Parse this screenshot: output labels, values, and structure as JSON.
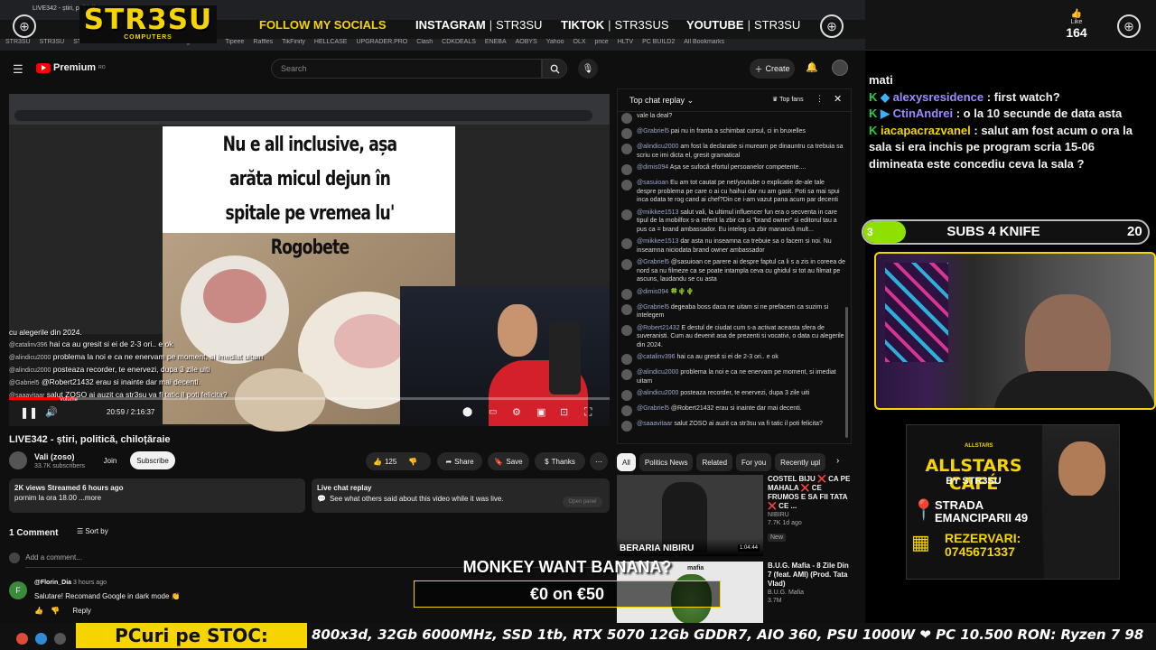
{
  "overlay": {
    "brand": "STR3SU",
    "brand_sub": "COMPUTERS",
    "follow": "FOLLOW MY SOCIALS",
    "socials": [
      {
        "platform": "INSTAGRAM",
        "handle": "STR3SU"
      },
      {
        "platform": "TIKTOK",
        "handle": "STR3SUS"
      },
      {
        "platform": "YOUTUBE",
        "handle": "STR3SU"
      }
    ],
    "like_label": "Like",
    "like_count": "164",
    "monkey_text": "MONKEY WANT BANANA?",
    "goal_text": "€0 on €50",
    "goal_progress": 0,
    "ticker_label": "PCuri pe STOC:",
    "ticker_text": "800x3d, 32Gb 6000MHz, SSD 1tb, RTX 5070 12Gb GDDR7, AIO 360, PSU 1000W  ❤ PC 10.500 RON: Ryzen 7 98"
  },
  "browser": {
    "tab_title": "LIVE342 - știri, politică...",
    "bookmarks": [
      "STR3SU",
      "STR3SU",
      "STR3SU",
      "STR3SUS",
      "STR3SUzu",
      "gambler.ro",
      "Tipeee",
      "Raffles",
      "TikFinity",
      "HELLCASE",
      "UPGRADER.PRO",
      "Clash",
      "CDKDEALS",
      "ENEBA",
      "AOBYS",
      "Yahoo",
      "OLX",
      "price",
      "HLTV",
      "PC BUILD2",
      "All Bookmarks"
    ]
  },
  "youtube": {
    "logo": "Premium",
    "logo_sup": "RO",
    "search_placeholder": "Search",
    "create": "Create",
    "video_title": "LIVE342 - știri, politică, chiloțăraie",
    "channel": "Vali (zoso)",
    "subscribers": "33.7K subscribers",
    "join": "Join",
    "subscribe": "Subscribe",
    "likes": "125",
    "share": "Share",
    "save": "Save",
    "thanks": "Thanks",
    "time": "20:59 / 2:16:37",
    "desc_line1": "2K views  Streamed 6 hours ago",
    "desc_line2": "pornim la ora 18.00 ...more",
    "chat_replay_title": "Live chat replay",
    "chat_replay_desc": "See what others said about this video while it was live.",
    "open_panel": "Open panel",
    "comments_count": "1 Comment",
    "sort_by": "Sort by",
    "add_comment": "Add a comment...",
    "comment_author": "@Florin_Dia",
    "comment_time": "3 hours ago",
    "comment_text": "Salutare! Recomand Google in dark mode 👏",
    "reply": "Reply",
    "volume_label": "Volume"
  },
  "meme": {
    "text": "Nu e all inclusive, așa arăta micul dejun în spitale pe vremea lu' Rogobete"
  },
  "video_overlay_chat": [
    {
      "user": "",
      "text": "cu alegerile din 2024."
    },
    {
      "user": "@catalinv396",
      "text": "hai ca au gresit si ei de 2-3 ori.. e ok"
    },
    {
      "user": "@alindicu2000",
      "text": "problema la noi e ca ne enervam pe moment, si imediat uitam"
    },
    {
      "user": "@alindicu2000",
      "text": "posteaza recorder, te enervezi, dupa 3 zile uiti"
    },
    {
      "user": "@Gabriel5",
      "text": "@Robert21432 erau si inainte dar mai decenti."
    },
    {
      "user": "@saaavitaar",
      "text": "salut ZOSO ai auzit ca str3su va fi tatic il poti felicita?"
    }
  ],
  "live_chat": {
    "header": "Top chat replay",
    "top_fans": "Top fans",
    "messages": [
      {
        "user": "",
        "text": "vale la deal?"
      },
      {
        "user": "@Grabriel5",
        "text": "pai nu in franta a schimbat cursul, ci in bruxelles"
      },
      {
        "user": "@alindicu2000",
        "text": "am fost la declaratie si muream pe dinauntru ca trebuia sa scriu ce imi dicta el, gresit gramatical"
      },
      {
        "user": "@dimis094",
        "text": "Așa se sufocă efortul persoanelor competente...."
      },
      {
        "user": "@sasuioan",
        "text": "Eu am tot cautat pe net/youtube o explicatie de-ale tale despre problema pe care o ai cu haihui dar nu am gasit. Poti sa mai spui inca odata te rog cand ai chef?Din ce i-am vazut pana acum par decenti"
      },
      {
        "user": "@miikkee1513",
        "text": "salut vali, la ultimul influencer fun era o secventa in care tipul de la mobilfox s-a referit la zbir ca si \"brand owner\" si editorul tau a pus ca = brand ambassador. Eu inteleg ca zbir manancă mult..."
      },
      {
        "user": "@miikkee1513",
        "text": "dar asta nu inseamna ca trebuie sa o facem si noi. Nu inseamna niciodata brand owner ambassador"
      },
      {
        "user": "@Grabriel5",
        "text": "@sasuioan ce parere ai despre faptul ca li s a zis in coreea de nord sa nu filmeze ca se poate intampla ceva cu ghidul si tot au filmat pe ascuns, laudandu se cu asta"
      },
      {
        "user": "@dimis094",
        "text": "🍀🌵🌵"
      },
      {
        "user": "@Grabriel5",
        "text": "degeaba boss daca ne uitam si ne prefacem ca suzim si intelegem"
      },
      {
        "user": "@Robert21432",
        "text": "E destul de ciudat cum s-a activat aceasta sfera de suveranisti. Cum au devenit asa de prezenti si vocativi, o data cu alegerile din 2024."
      },
      {
        "user": "@catalinv396",
        "text": "hai ca au gresit si ei de 2-3 ori.. e ok"
      },
      {
        "user": "@alindicu2000",
        "text": "problema la noi e ca ne enervam pe moment, si imediat uitam"
      },
      {
        "user": "@alindicu2000",
        "text": "posteaza recorder, te enervezi, dupa 3 zile uiti"
      },
      {
        "user": "@Grabriel5",
        "text": "@Robert21432 erau si inainte dar mai decenti."
      },
      {
        "user": "@saaavitaar",
        "text": "salut ZOSO ai auzit ca str3su va fi tatic il poti felicita?"
      }
    ]
  },
  "chips": [
    "All",
    "Politics News",
    "Related",
    "For you",
    "Recently upl"
  ],
  "recommended": [
    {
      "title": "COSTEL BIJU ❌ CA PE MAHALA ❌ CE FRUMOS E SA FII TATA ❌ CE ...",
      "channel": "NIBIRU",
      "meta": "7.7K  1d ago",
      "badge": "New",
      "thumb_text": "BERARIA NIBIRU",
      "duration": "1:04:44"
    },
    {
      "title": "B.U.G. Mafia - 8 Zile Din 7 (feat. AMI) (Prod. Tata Vlad)",
      "channel": "B.U.G. Mafia",
      "meta": "3.7M",
      "badge": "",
      "thumb_text": "mafia",
      "duration": ""
    }
  ],
  "twitch_chat": [
    {
      "user": "",
      "text": "mati"
    },
    {
      "user": "alexysresidence",
      "text": ": first watch?"
    },
    {
      "user": "CtinAndrei",
      "text": ": o la 10 secunde de data asta"
    },
    {
      "user": "iacapacrazvanel",
      "text": ": salut am fost acum o ora la sala si era inchis pe program scria 15-06 dimineata este concediu ceva la sala ?"
    }
  ],
  "subs_goal": {
    "current": "3",
    "label": "SUBS 4 KNIFE",
    "target": "20",
    "progress": 0.15
  },
  "ad": {
    "badge": "ALLSTARS",
    "title": "ALLSTARS CAFÉ",
    "by": "BY STR3SU",
    "street_label": "STRADA",
    "street": "EMANCIPARII 49",
    "rez_label": "REZERVARI:",
    "phone": "0745671337"
  },
  "colors": {
    "brand": "#f5d400",
    "yt_red": "#ff0000",
    "subs_fill": "#8ee000",
    "chat_user": "#9b8cff"
  }
}
